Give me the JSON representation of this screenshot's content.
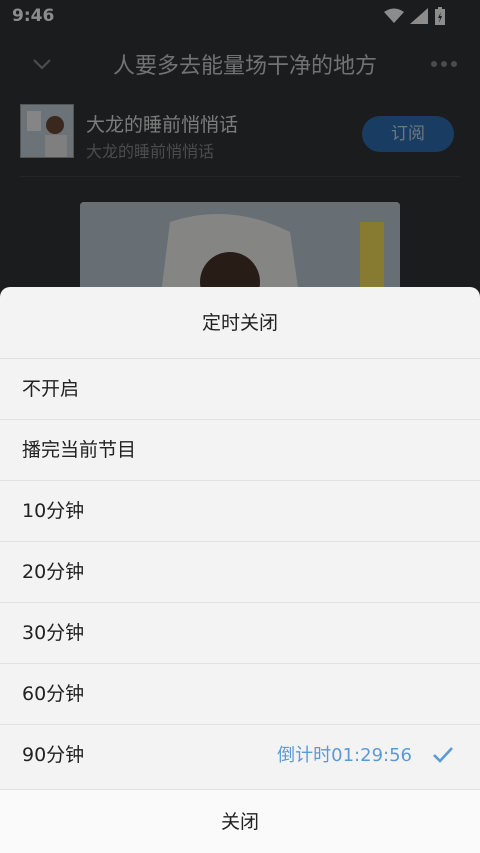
{
  "status_bar": {
    "time": "9:46"
  },
  "player": {
    "title": "人要多去能量场干净的地方",
    "album_name": "大龙的睡前悄悄话",
    "album_subtitle": "大龙的睡前悄悄话",
    "subscribe_label": "订阅"
  },
  "timer_sheet": {
    "title": "定时关闭",
    "options": [
      {
        "label": "不开启"
      },
      {
        "label": "播完当前节目"
      },
      {
        "label": "10分钟"
      },
      {
        "label": "20分钟"
      },
      {
        "label": "30分钟"
      },
      {
        "label": "60分钟"
      },
      {
        "label": "90分钟"
      }
    ],
    "selected_countdown": "倒计时01:29:56",
    "close_label": "关闭"
  },
  "colors": {
    "accent": "#5c9ad6",
    "subscribe_bg": "#2f6fb3"
  }
}
